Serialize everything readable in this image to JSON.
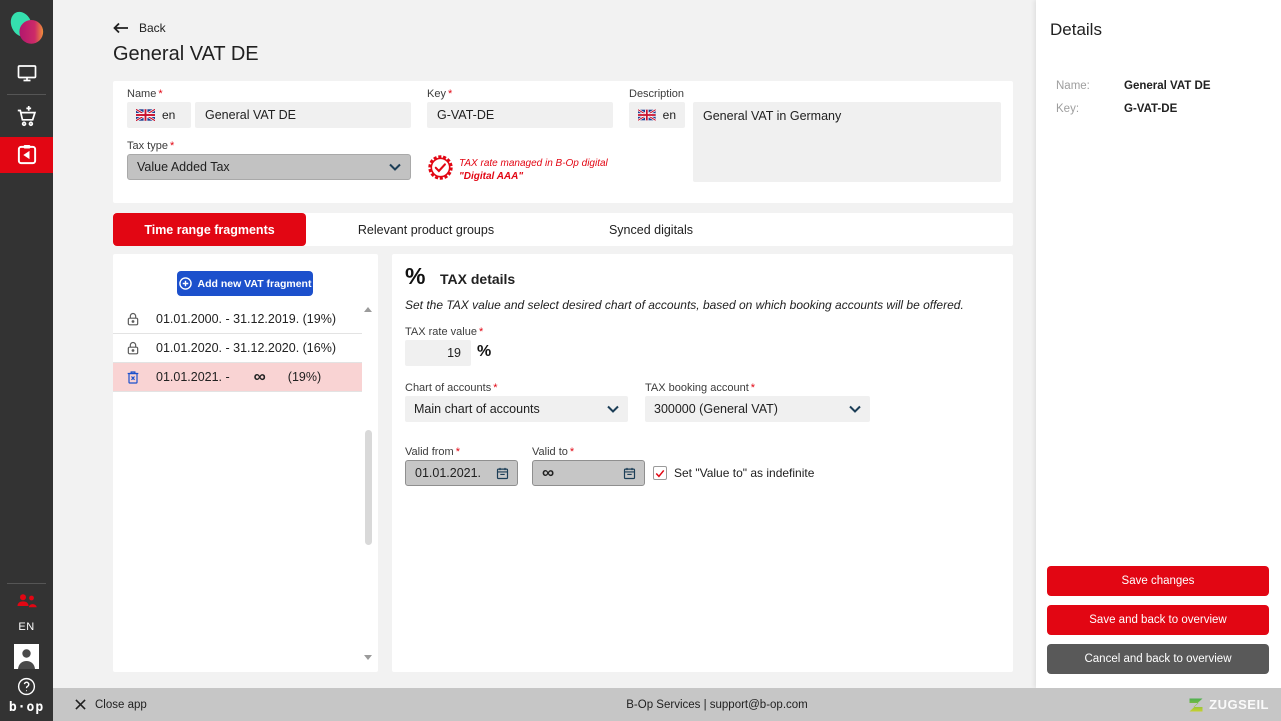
{
  "misc": {
    "required_mark": "*",
    "infinity_glyph": "∞",
    "percent_glyph": "%"
  },
  "colors": {
    "accent_red": "#e20613",
    "accent_blue": "#1c50cc",
    "selected_pink": "#f9d3d3",
    "sidebar_bg": "#333333",
    "footer_bg": "#c6c6c6"
  },
  "sidebar": {
    "language": "EN",
    "brand": "b·op"
  },
  "header": {
    "back_label": "Back",
    "title": "General VAT DE"
  },
  "form": {
    "name_label": "Name",
    "name_lang": "en",
    "name_value": "General VAT DE",
    "tax_type_label": "Tax type",
    "tax_type_value": "Value Added Tax",
    "key_label": "Key",
    "key_value": "G-VAT-DE",
    "description_label": "Description",
    "description_lang": "en",
    "description_value": "General VAT in Germany",
    "managed_note_line1": "TAX rate managed in B-Op digital",
    "managed_note_line2": "\"Digital AAA\""
  },
  "tabs": [
    {
      "label": "Time range fragments",
      "active": true
    },
    {
      "label": "Relevant product groups",
      "active": false
    },
    {
      "label": "Synced digitals",
      "active": false
    }
  ],
  "fragments": {
    "add_button_label": "Add new VAT fragment",
    "items": [
      {
        "text": "01.01.2000. - 31.12.2019. (19%)",
        "icon": "lock",
        "selected": false
      },
      {
        "text": "01.01.2020. - 31.12.2020. (16%)",
        "icon": "lock",
        "selected": false
      },
      {
        "text": "01.01.2021. -",
        "percent": "(19%)",
        "icon": "delete",
        "selected": true,
        "valid_to_infinite": true
      }
    ]
  },
  "tax_details": {
    "title": "TAX details",
    "subtitle": "Set the TAX value and select desired chart of accounts, based on which booking accounts will be offered.",
    "rate_label": "TAX rate value",
    "rate_value": "19",
    "chart_label": "Chart of accounts",
    "chart_value": "Main chart of accounts",
    "booking_label": "TAX booking account",
    "booking_value": "300000 (General VAT)",
    "valid_from_label": "Valid from",
    "valid_from_value": "01.01.2021.",
    "valid_to_label": "Valid to",
    "checkbox_label": "Set \"Value to\" as indefinite",
    "checkbox_checked": true
  },
  "details_panel": {
    "title": "Details",
    "name_label": "Name:",
    "name_value": "General VAT DE",
    "key_label": "Key:",
    "key_value": "G-VAT-DE",
    "save_button": "Save changes",
    "save_back_button": "Save and back to overview",
    "cancel_button": "Cancel and back to overview"
  },
  "footer": {
    "close_label": "Close app",
    "center_text": "B-Op Services | support@b-op.com",
    "brand": "ZUGSEIL"
  }
}
